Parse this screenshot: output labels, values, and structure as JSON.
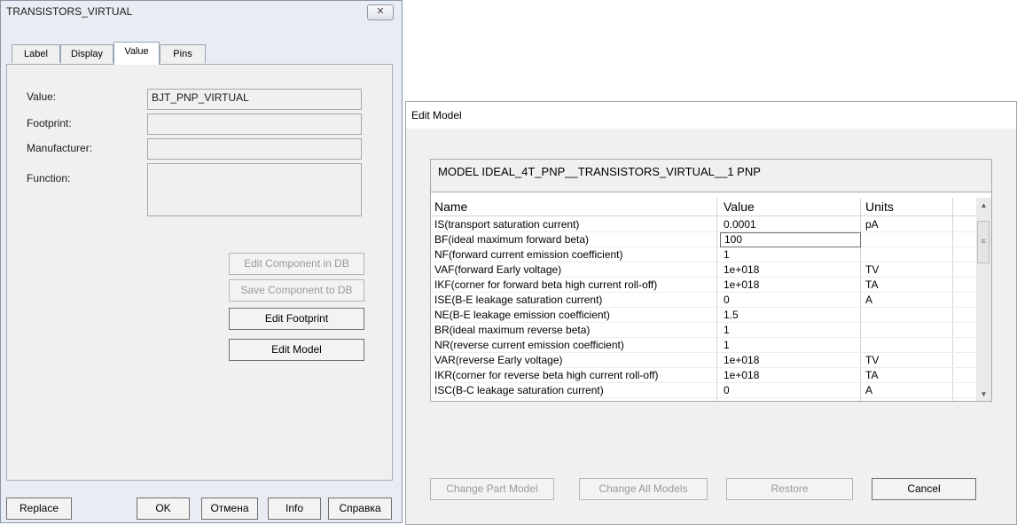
{
  "component_dialog": {
    "title": "TRANSISTORS_VIRTUAL",
    "close_glyph": "✕",
    "tabs": [
      {
        "label": "Label"
      },
      {
        "label": "Display"
      },
      {
        "label": "Value",
        "active": true
      },
      {
        "label": "Pins"
      }
    ],
    "fields": {
      "value_label": "Value:",
      "value": "BJT_PNP_VIRTUAL",
      "footprint_label": "Footprint:",
      "footprint": "",
      "manufacturer_label": "Manufacturer:",
      "manufacturer": "",
      "function_label": "Function:",
      "function": ""
    },
    "buttons": {
      "edit_component_db": "Edit Component in DB",
      "save_component_db": "Save Component to DB",
      "edit_footprint": "Edit Footprint",
      "edit_model": "Edit Model"
    },
    "footer": {
      "replace": "Replace",
      "ok": "OK",
      "cancel": "Отмена",
      "info": "Info",
      "help": "Справка"
    }
  },
  "edit_model_dialog": {
    "title": "Edit Model",
    "model_header": "MODEL IDEAL_4T_PNP__TRANSISTORS_VIRTUAL__1 PNP",
    "columns": {
      "name": "Name",
      "value": "Value",
      "units": "Units"
    },
    "rows": [
      {
        "name": "IS(transport saturation current)",
        "value": "0.0001",
        "units": "pA"
      },
      {
        "name": "BF(ideal maximum forward beta)",
        "value": "100",
        "units": ""
      },
      {
        "name": "NF(forward current emission coefficient)",
        "value": "1",
        "units": ""
      },
      {
        "name": "VAF(forward Early voltage)",
        "value": "1e+018",
        "units": "TV"
      },
      {
        "name": "IKF(corner for forward beta high current roll-off)",
        "value": "1e+018",
        "units": "TA"
      },
      {
        "name": "ISE(B-E leakage saturation current)",
        "value": "0",
        "units": "A"
      },
      {
        "name": "NE(B-E leakage emission coefficient)",
        "value": "1.5",
        "units": ""
      },
      {
        "name": "BR(ideal maximum reverse beta)",
        "value": "1",
        "units": ""
      },
      {
        "name": "NR(reverse current emission coefficient)",
        "value": "1",
        "units": ""
      },
      {
        "name": "VAR(reverse Early voltage)",
        "value": "1e+018",
        "units": "TV"
      },
      {
        "name": "IKR(corner for reverse beta high current roll-off)",
        "value": "1e+018",
        "units": "TA"
      },
      {
        "name": "ISC(B-C leakage saturation current)",
        "value": "0",
        "units": "A"
      }
    ],
    "editing_row_index": 1,
    "buttons": {
      "change_part_model": "Change Part Model",
      "change_all_models": "Change All Models",
      "restore": "Restore",
      "cancel": "Cancel"
    }
  }
}
